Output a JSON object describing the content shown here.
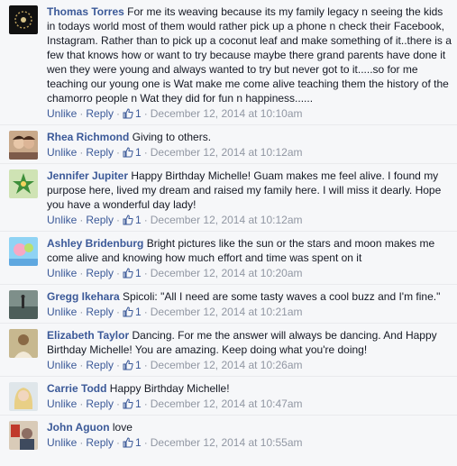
{
  "comments": [
    {
      "author": "Thomas Torres",
      "text": "For me its weaving because its my family legacy n seeing the kids in todays world most of them would rather pick up a phone n check their Facebook, Instagram. Rather than to pick up a coconut leaf and make something of it..there is a few that knows how or want to try because maybe there grand parents have done it wen they were young and always wanted to try but never got to it.....so for me teaching our young one is Wat make me come alive teaching them the history of the chamorro people n Wat they did for fun n happiness......",
      "unlike": "Unlike",
      "reply": "Reply",
      "likes": "1",
      "date": "December 12, 2014 at 10:10am"
    },
    {
      "author": "Rhea Richmond",
      "text": "Giving to others.",
      "unlike": "Unlike",
      "reply": "Reply",
      "likes": "1",
      "date": "December 12, 2014 at 10:12am"
    },
    {
      "author": "Jennifer Jupiter",
      "text": "Happy Birthday Michelle! Guam makes me feel alive. I found my purpose here, lived my dream and raised my family here. I will miss it dearly. Hope you have a wonderful day lady!",
      "unlike": "Unlike",
      "reply": "Reply",
      "likes": "1",
      "date": "December 12, 2014 at 10:12am"
    },
    {
      "author": "Ashley Bridenburg",
      "text": "Bright pictures like the sun or the stars and moon makes me come alive and knowing how much effort and time was spent on it",
      "unlike": "Unlike",
      "reply": "Reply",
      "likes": "1",
      "date": "December 12, 2014 at 10:20am"
    },
    {
      "author": "Gregg Ikehara",
      "text": "Spicoli: \"All I need are some tasty waves a cool buzz and I'm fine.\"",
      "unlike": "Unlike",
      "reply": "Reply",
      "likes": "1",
      "date": "December 12, 2014 at 10:21am"
    },
    {
      "author": "Elizabeth Taylor",
      "text": "Dancing. For me the answer will always be dancing. And Happy Birthday Michelle! You are amazing. Keep doing what you're doing!",
      "unlike": "Unlike",
      "reply": "Reply",
      "likes": "1",
      "date": "December 12, 2014 at 10:26am"
    },
    {
      "author": "Carrie Todd",
      "text": "Happy Birthday Michelle!",
      "unlike": "Unlike",
      "reply": "Reply",
      "likes": "1",
      "date": "December 12, 2014 at 10:47am"
    },
    {
      "author": "John Aguon",
      "text": "love",
      "unlike": "Unlike",
      "reply": "Reply",
      "likes": "1",
      "date": "December 12, 2014 at 10:55am"
    }
  ],
  "colors": {
    "link": "#3b5998",
    "text": "#141823",
    "meta": "#9197a3",
    "background": "#f6f7f9"
  },
  "icons": {
    "like": "thumbs-up-icon"
  }
}
